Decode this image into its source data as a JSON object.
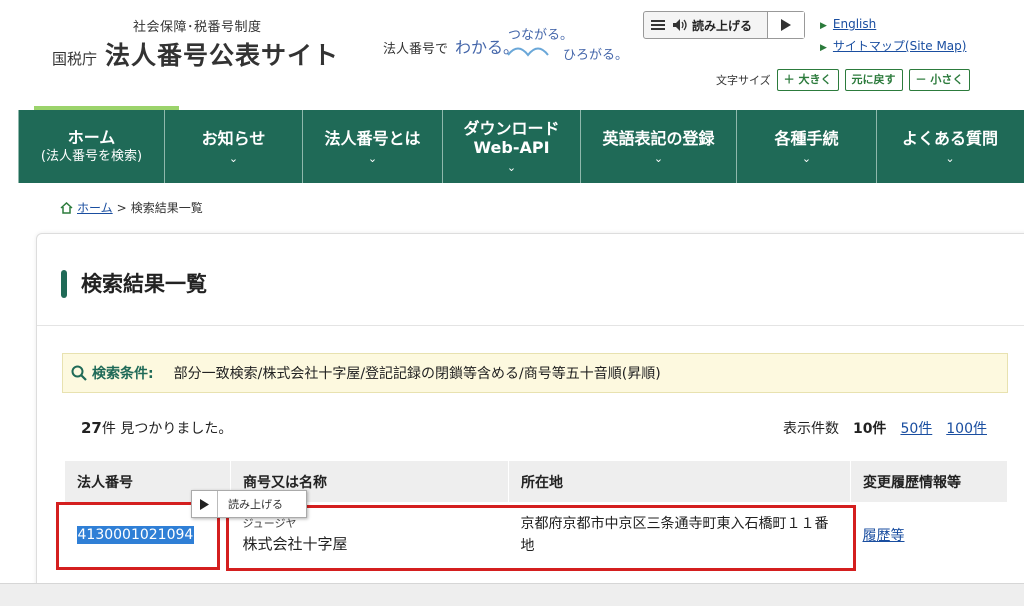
{
  "header": {
    "subtitle": "社会保障･税番号制度",
    "agency": "国税庁",
    "site_title": "法人番号公表サイト",
    "tagline_a": "法人番号で",
    "tagline_b": "わかる。",
    "tagline_c": "つながる。",
    "tagline_d": "ひろがる。",
    "tts_label": "読み上げる",
    "english_link": "English",
    "sitemap_link": "サイトマップ(Site Map)",
    "font_size_label": "文字サイズ",
    "font_bigger": "＋ 大きく",
    "font_reset": "元に戻す",
    "font_smaller": "－ 小さく"
  },
  "nav": {
    "items": [
      {
        "label": "ホーム",
        "sub": "(法人番号を検索)"
      },
      {
        "label": "お知らせ"
      },
      {
        "label": "法人番号とは"
      },
      {
        "label": "ダウンロード",
        "sub": "Web-API"
      },
      {
        "label": "英語表記の登録"
      },
      {
        "label": "各種手続"
      },
      {
        "label": "よくある質問"
      }
    ]
  },
  "breadcrumb": {
    "home": "ホーム",
    "sep": ">",
    "current": "検索結果一覧"
  },
  "main": {
    "page_title": "検索結果一覧",
    "condition_label": "検索条件:",
    "condition_text": "部分一致検索/株式会社十字屋/登記記録の閉鎖等含める/商号等五十音順(昇順)",
    "count_number": "27",
    "count_suffix": "件 見つかりました。",
    "per_page_label": "表示件数",
    "per_page_current": "10件",
    "per_page_50": "50件",
    "per_page_100": "100件",
    "table": {
      "headers": [
        "法人番号",
        "商号又は名称",
        "所在地",
        "変更履歴情報等"
      ],
      "rows": [
        {
          "number": "4130001021094",
          "kana": "ジュージヤ",
          "name": "株式会社十字屋",
          "address": "京都府京都市中京区三条通寺町東入石橋町１１番地",
          "history": "履歴等"
        }
      ]
    },
    "popup_label": "読み上げる"
  }
}
